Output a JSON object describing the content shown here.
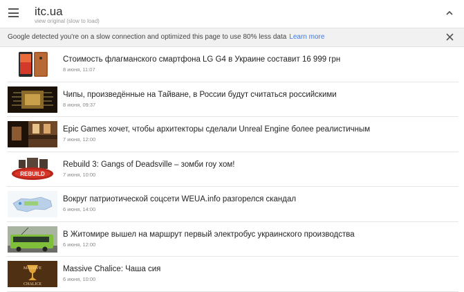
{
  "header": {
    "site": "itc.ua",
    "subtitle": "view original (slow to load)"
  },
  "notice": {
    "text": "Google detected you're on a slow connection and optimized this page to use 80% less data",
    "link": "Learn more"
  },
  "articles": [
    {
      "title": "Стоимость флагманского смартфона LG G4 в Украине составит 16 999 грн",
      "date": "8 июня, 11:07",
      "thumb": "smartphone"
    },
    {
      "title": "Чипы, произведённые на Тайване, в России будут считаться российскими",
      "date": "8 июня, 09:37",
      "thumb": "chip"
    },
    {
      "title": "Epic Games хочет, чтобы архитекторы сделали Unreal Engine более реалистичным",
      "date": "7 июня, 12:00",
      "thumb": "interior"
    },
    {
      "title": "Rebuild 3: Gangs of Deadsville – зомби гоу хом!",
      "date": "7 июня, 10:00",
      "thumb": "rebuild-logo"
    },
    {
      "title": "Вокруг патриотической соцсети WEUA.info разгорелся скандал",
      "date": "6 июня, 14:00",
      "thumb": "map"
    },
    {
      "title": "В Житомире вышел на маршрут первый электробус украинского производства",
      "date": "6 июня, 12:00",
      "thumb": "bus"
    },
    {
      "title": "Massive Chalice: Чаша сия",
      "date": "6 июня, 10:00",
      "thumb": "massive-chalice"
    }
  ]
}
